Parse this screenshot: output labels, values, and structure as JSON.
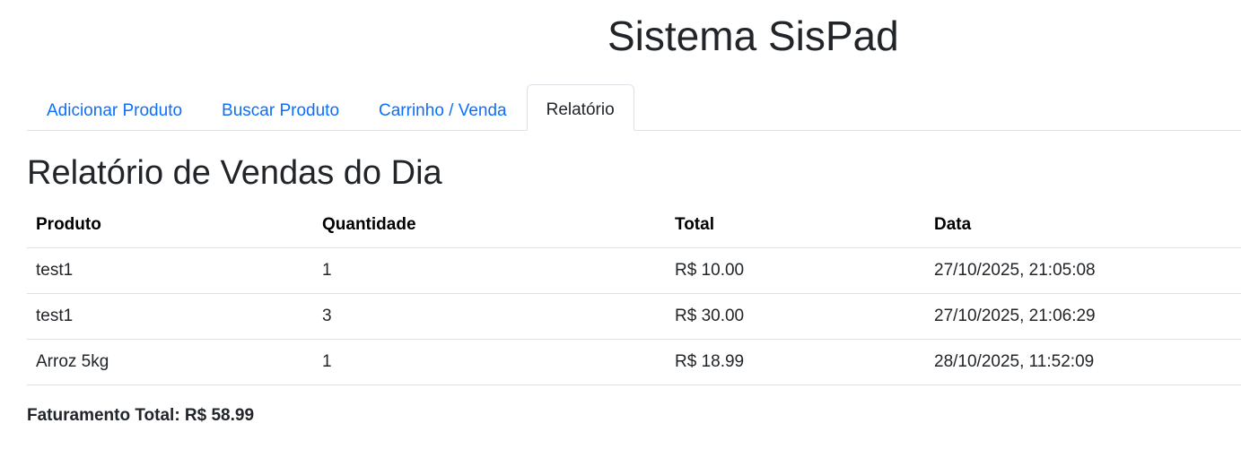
{
  "app": {
    "title": "Sistema SisPad"
  },
  "tabs": [
    {
      "label": "Adicionar Produto",
      "active": false
    },
    {
      "label": "Buscar Produto",
      "active": false
    },
    {
      "label": "Carrinho / Venda",
      "active": false
    },
    {
      "label": "Relatório",
      "active": true
    }
  ],
  "report": {
    "title": "Relatório de Vendas do Dia",
    "columns": [
      "Produto",
      "Quantidade",
      "Total",
      "Data"
    ],
    "rows": [
      {
        "produto": "test1",
        "quantidade": "1",
        "total": "R$ 10.00",
        "data": "27/10/2025, 21:05:08"
      },
      {
        "produto": "test1",
        "quantidade": "3",
        "total": "R$ 30.00",
        "data": "27/10/2025, 21:06:29"
      },
      {
        "produto": "Arroz 5kg",
        "quantidade": "1",
        "total": "R$ 18.99",
        "data": "28/10/2025, 11:52:09"
      }
    ],
    "total_text": "Faturamento Total: R$ 58.99"
  },
  "colors": {
    "link": "#0d6efd",
    "text": "#212529",
    "border": "#dee2e6"
  }
}
